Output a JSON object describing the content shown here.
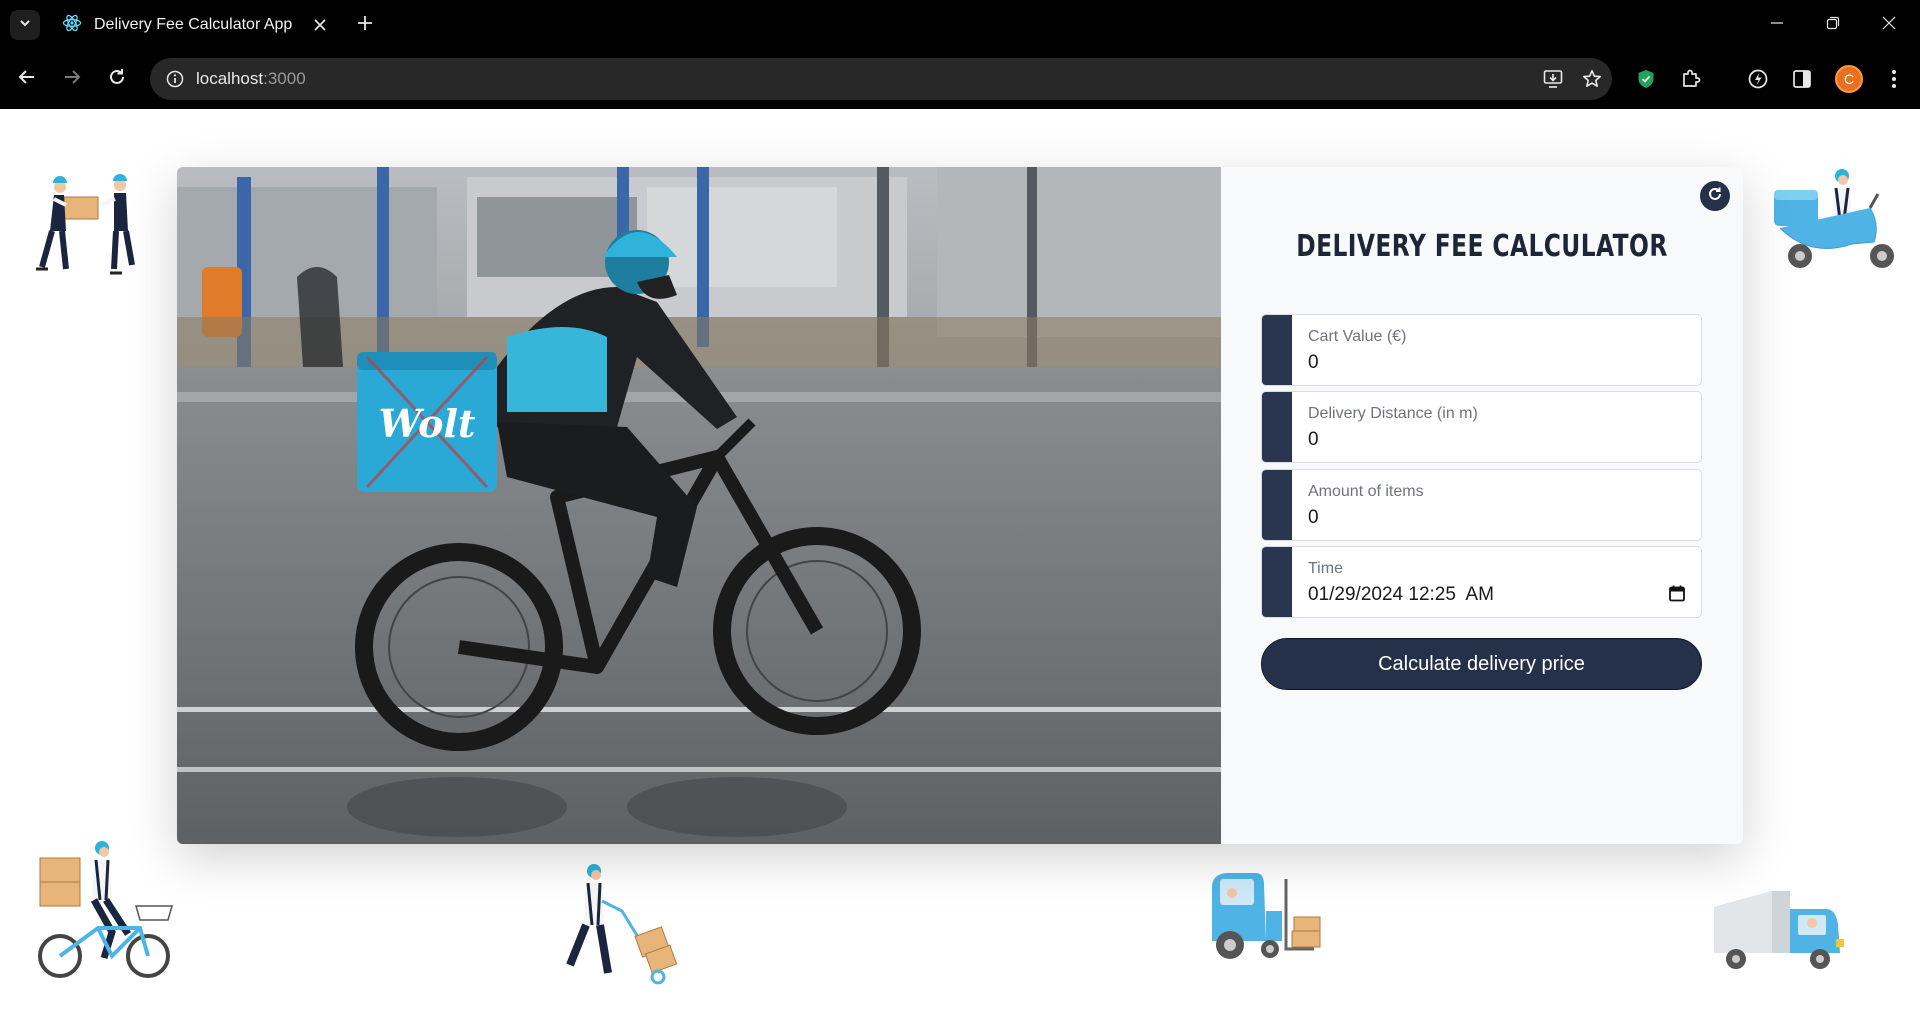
{
  "browser": {
    "tab_title": "Delivery Fee Calculator App",
    "url_host": "localhost",
    "url_port": ":3000",
    "profile_initial": "C"
  },
  "app": {
    "title": "DELIVERY FEE CALCULATOR",
    "fields": [
      {
        "label": "Cart Value (€)",
        "value": "0"
      },
      {
        "label": "Delivery Distance (in m)",
        "value": "0"
      },
      {
        "label": "Amount of items",
        "value": "0"
      },
      {
        "label": "Time",
        "value": "01/29/2024 12:25  AM"
      }
    ],
    "calculate_label": "Calculate delivery price",
    "photo_bag_text": "Wolt"
  },
  "colors": {
    "navy": "#243149",
    "accent_blue": "#2fb2dc",
    "card_bg": "#f8f9fb"
  }
}
